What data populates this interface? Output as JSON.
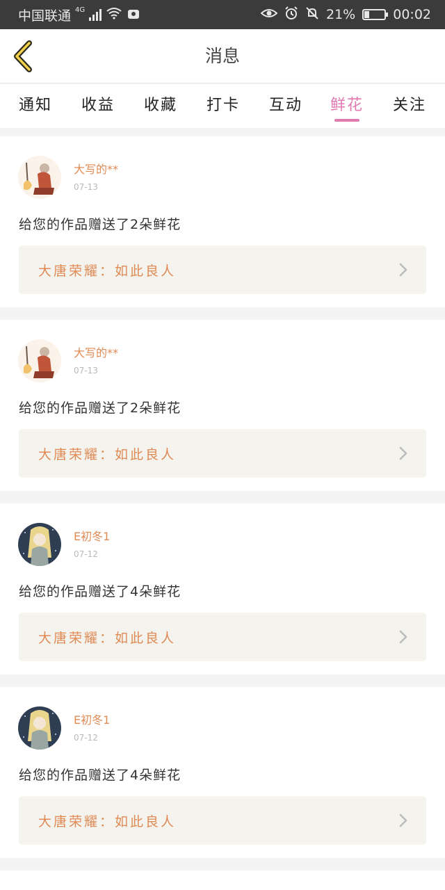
{
  "status": {
    "carrier": "中国联通",
    "network": "4G",
    "battery": "21%",
    "battery_level": 0.21,
    "time": "00:02"
  },
  "header": {
    "title": "消息",
    "back_icon": "chevron-left-icon"
  },
  "tabs": [
    {
      "label": "通知",
      "active": false
    },
    {
      "label": "收益",
      "active": false
    },
    {
      "label": "收藏",
      "active": false
    },
    {
      "label": "打卡",
      "active": false
    },
    {
      "label": "互动",
      "active": false
    },
    {
      "label": "鲜花",
      "active": true
    },
    {
      "label": "关注",
      "active": false
    }
  ],
  "colors": {
    "accent": "#e07ab1",
    "name": "#e08a55",
    "link_bg": "#f4f3ee",
    "status_bar": "#3b3b3b"
  },
  "notifications": [
    {
      "user": "大写的**",
      "date": "07-13",
      "message": "给您的作品赠送了2朵鲜花",
      "work": "大唐荣耀：如此良人",
      "avatar": "warrior-avatar"
    },
    {
      "user": "大写的**",
      "date": "07-13",
      "message": "给您的作品赠送了2朵鲜花",
      "work": "大唐荣耀：如此良人",
      "avatar": "warrior-avatar"
    },
    {
      "user": "E初冬1",
      "date": "07-12",
      "message": "给您的作品赠送了4朵鲜花",
      "work": "大唐荣耀：如此良人",
      "avatar": "girl-avatar"
    },
    {
      "user": "E初冬1",
      "date": "07-12",
      "message": "给您的作品赠送了4朵鲜花",
      "work": "大唐荣耀：如此良人",
      "avatar": "girl-avatar"
    }
  ]
}
